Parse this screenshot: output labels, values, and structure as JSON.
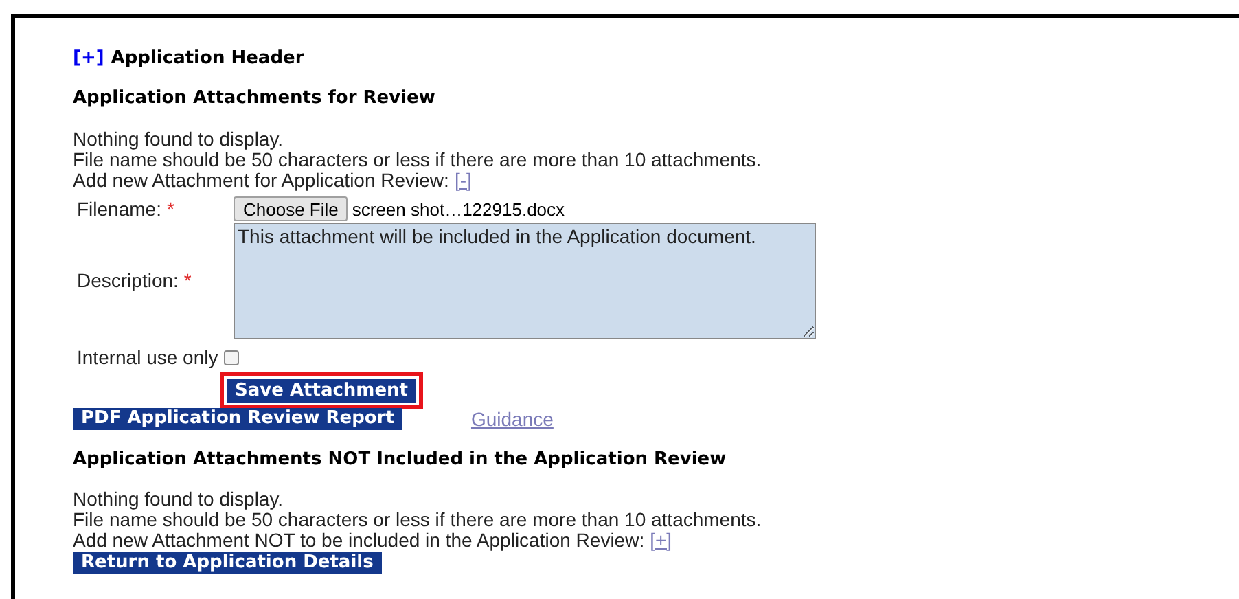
{
  "header": {
    "toggle": "[+]",
    "title": "Application Header"
  },
  "review_section": {
    "title": "Application Attachments for Review",
    "messages": [
      "Nothing found to display.",
      "File name should be 50 characters or less if there are more than 10 attachments."
    ],
    "add_label": "Add new Attachment for Application Review:",
    "add_toggle": "[-]"
  },
  "form": {
    "filename_label": "Filename:",
    "required_mark": "*",
    "choose_file_button": "Choose File",
    "file_name": "screen shot…122915.docx",
    "description_label": "Description:",
    "description_value": "This attachment will be included in the Application document.",
    "internal_use_label": "Internal use only",
    "internal_use_checked": false,
    "save_button": {
      "label": "Save Attachment",
      "highlighted": true
    }
  },
  "actions": {
    "pdf_button": "PDF Application Review Report",
    "guidance_link": "Guidance"
  },
  "not_included_section": {
    "title": "Application Attachments NOT Included in the Application Review",
    "messages": [
      "Nothing found to display.",
      "File name should be 50 characters or less if there are more than 10 attachments."
    ],
    "add_label": "Add new Attachment NOT to be included in the Application Review:",
    "add_toggle": "[+]"
  },
  "return_button": "Return to Application Details"
}
